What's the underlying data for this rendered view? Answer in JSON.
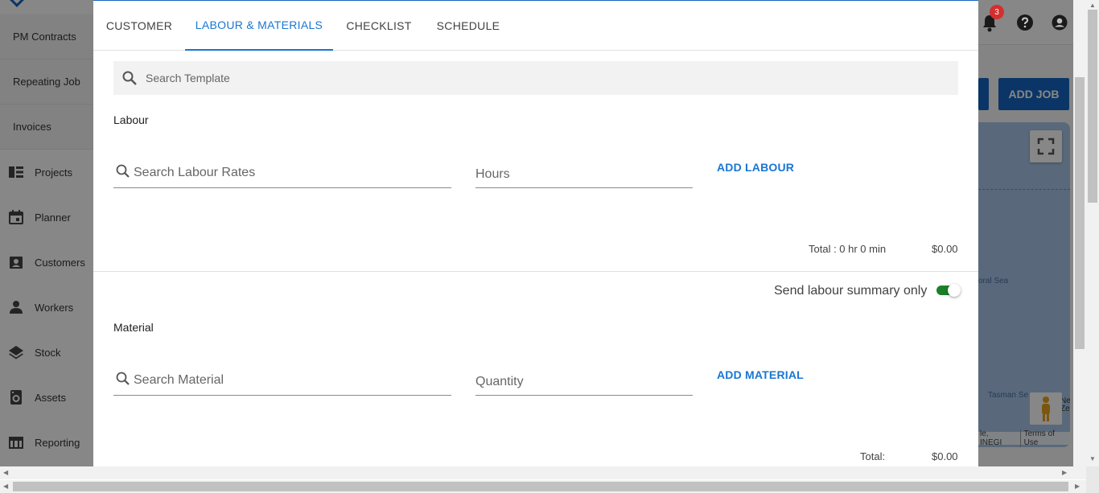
{
  "sidebar": {
    "sub_items": [
      {
        "label": "PM Contracts"
      },
      {
        "label": "Repeating Job"
      },
      {
        "label": "Invoices"
      }
    ],
    "items": [
      {
        "label": "Projects",
        "icon": "projects-icon"
      },
      {
        "label": "Planner",
        "icon": "calendar-icon"
      },
      {
        "label": "Customers",
        "icon": "contact-card-icon"
      },
      {
        "label": "Workers",
        "icon": "person-icon"
      },
      {
        "label": "Stock",
        "icon": "layers-icon"
      },
      {
        "label": "Assets",
        "icon": "washer-icon"
      },
      {
        "label": "Reporting",
        "icon": "table-icon"
      }
    ]
  },
  "header": {
    "notification_count": "3",
    "add_job_label": "ADD JOB"
  },
  "map": {
    "labels": [
      "oral Sea",
      "Tasman Se",
      "Nev",
      "Zeala"
    ],
    "attribution": "le, INEGI",
    "terms": "Terms of Use"
  },
  "dialog": {
    "tabs": [
      {
        "label": "CUSTOMER",
        "active": false
      },
      {
        "label": "LABOUR & MATERIALS",
        "active": true
      },
      {
        "label": "CHECKLIST",
        "active": false
      },
      {
        "label": "SCHEDULE",
        "active": false
      }
    ],
    "template_search": {
      "placeholder": "Search Template"
    },
    "labour": {
      "title": "Labour",
      "search_placeholder": "Search Labour Rates",
      "hours_placeholder": "Hours",
      "add_label": "ADD LABOUR",
      "total_label": "Total : 0 hr 0 min",
      "total_value": "$0.00"
    },
    "labour_summary": {
      "label": "Send labour summary only",
      "enabled": true
    },
    "material": {
      "title": "Material",
      "search_placeholder": "Search Material",
      "quantity_placeholder": "Quantity",
      "add_label": "ADD MATERIAL",
      "total_label": "Total:",
      "total_value": "$0.00"
    }
  },
  "colors": {
    "accent": "#1976d2",
    "brand_button": "#1565c0",
    "toggle_on": "#1b7f2a",
    "badge": "#d32f2f"
  }
}
